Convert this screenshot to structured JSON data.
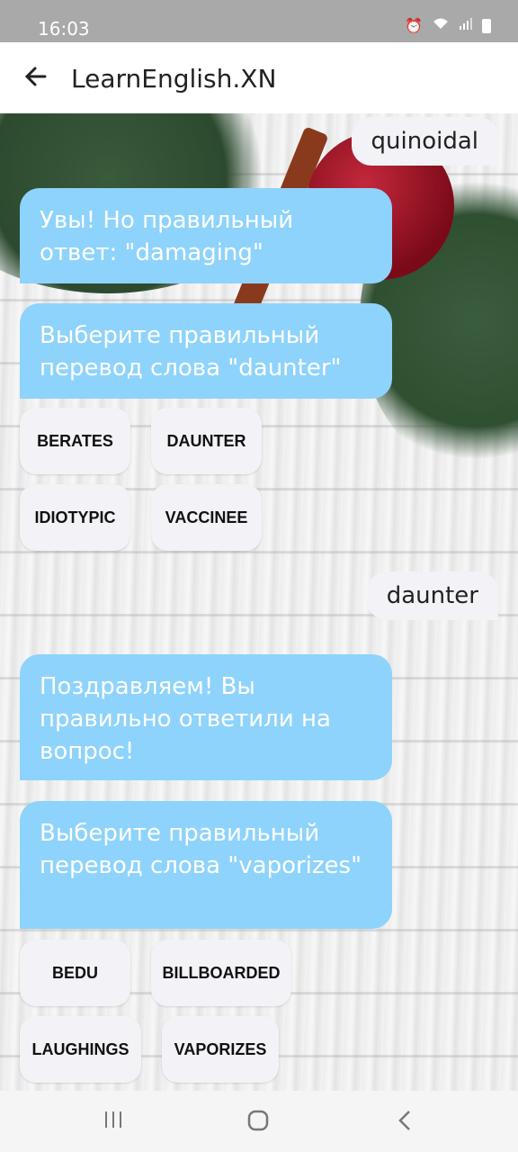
{
  "status": {
    "time": "16:03"
  },
  "app": {
    "title": "LearnEnglish.XN"
  },
  "messages": [
    {
      "from": "user",
      "text": "quinoidal"
    },
    {
      "from": "bot",
      "text": "Увы! Но правильный ответ: \"damaging\""
    },
    {
      "from": "bot",
      "text": "Выберите правильный перевод слова \"daunter\""
    },
    {
      "from": "user",
      "text": "daunter"
    },
    {
      "from": "bot",
      "text": "Поздравляем! Вы правильно ответили на вопрос!"
    },
    {
      "from": "bot",
      "text": "Выберите правильный перевод слова \"vaporizes\""
    }
  ],
  "options1": [
    "BERATES",
    "DAUNTER",
    "IDIOTYPIC",
    "VACCINEE"
  ],
  "options2": [
    "BEDU",
    "BILLBOARDED",
    "LAUGHINGS",
    "VAPORIZES"
  ],
  "colors": {
    "bot_bubble": "#8ed3fb",
    "user_bubble": "#f2f2f7",
    "status_bar": "#a9a9a9"
  },
  "icons": {
    "back": "arrow-left-icon",
    "alarm": "alarm-icon",
    "wifi": "wifi-icon",
    "signal": "signal-icon",
    "battery": "battery-icon"
  }
}
